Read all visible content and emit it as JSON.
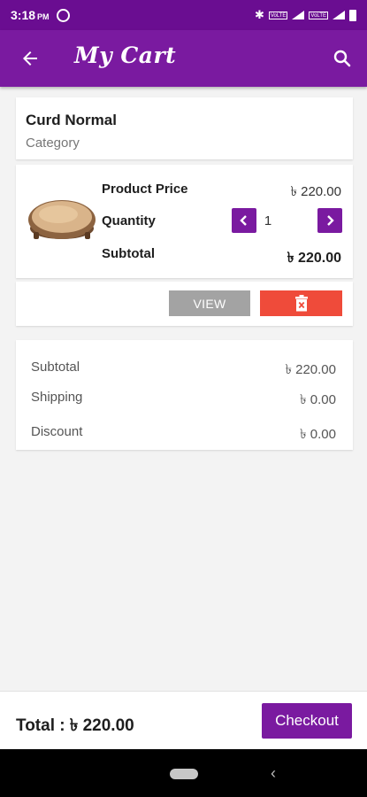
{
  "status_bar": {
    "time": "3:18",
    "ampm": "PM",
    "volte1": "VoLTE",
    "volte2": "VoLTE"
  },
  "app_bar": {
    "title": "My Cart"
  },
  "product": {
    "name": "Curd Normal",
    "category": "Category"
  },
  "details": {
    "price_label": "Product Price",
    "price_value": "৳ 220.00",
    "quantity_label": "Quantity",
    "quantity_value": "1",
    "subtotal_label": "Subtotal",
    "subtotal_value": "৳ 220.00"
  },
  "actions": {
    "view_label": "VIEW",
    "delete_icon": "trash-icon"
  },
  "summary": {
    "subtotal_label": "Subtotal",
    "subtotal_value": "৳ 220.00",
    "shipping_label": "Shipping",
    "shipping_value": "৳ 0.00",
    "discount_label": "Discount",
    "discount_value": "৳ 0.00"
  },
  "footer": {
    "total_text": "Total : ৳ 220.00",
    "checkout_label": "Checkout"
  },
  "colors": {
    "primary": "#7a1aa0",
    "status": "#6a0d91",
    "delete": "#ef4b3a",
    "view": "#a3a3a3"
  }
}
